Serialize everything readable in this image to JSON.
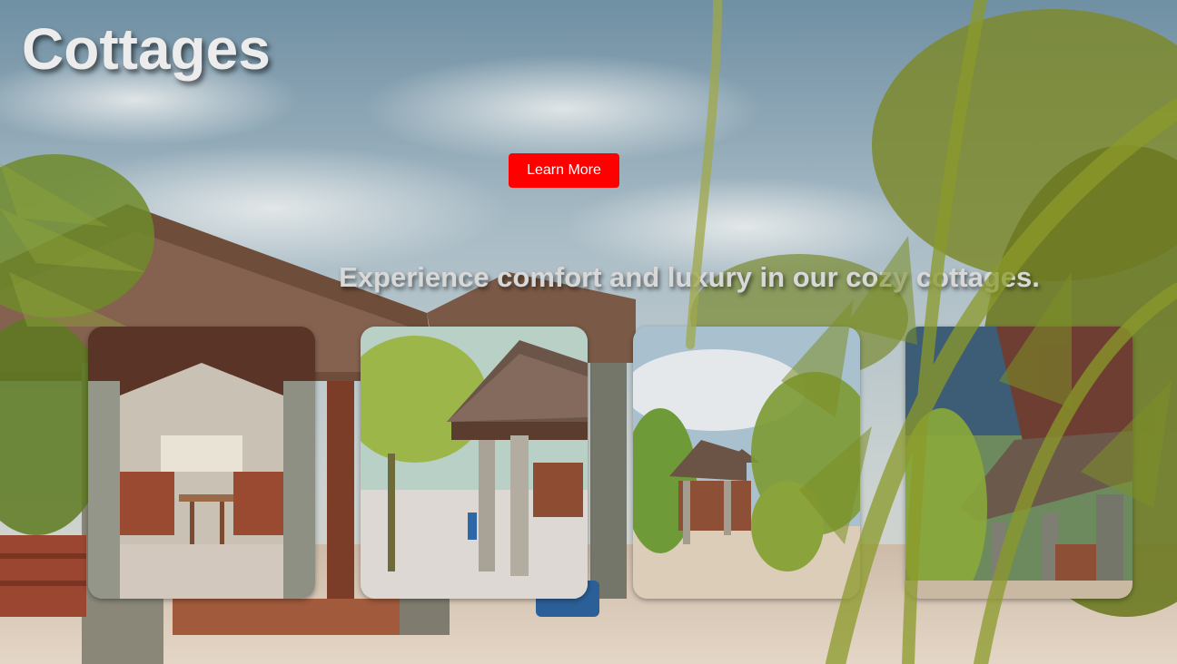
{
  "hero": {
    "title": "Cottages",
    "button_label": "Learn More",
    "tagline": "Experience comfort and luxury in our cozy cottages."
  },
  "gallery": {
    "cards": [
      {
        "name": "cottage-photo-1"
      },
      {
        "name": "cottage-photo-2"
      },
      {
        "name": "cottage-photo-3"
      },
      {
        "name": "cottage-photo-4"
      }
    ]
  },
  "colors": {
    "accent_button": "#ff0000",
    "title_text": "#ececec",
    "tagline_text": "#d8d8d8"
  }
}
